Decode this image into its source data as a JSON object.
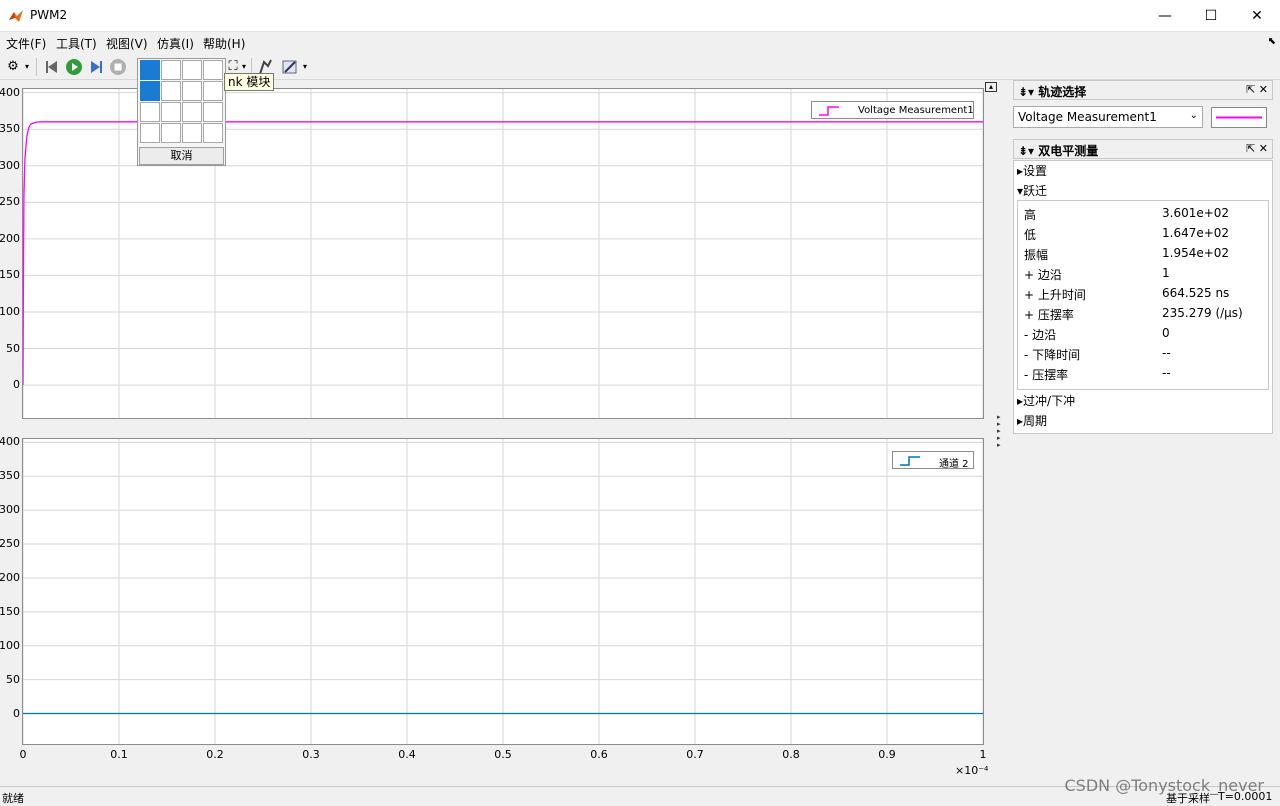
{
  "window": {
    "title": "PWM2",
    "minimize": "—",
    "maximize": "☐",
    "close": "✕"
  },
  "menu": [
    "文件(F)",
    "工具(T)",
    "视图(V)",
    "仿真(I)",
    "帮助(H)"
  ],
  "toolbar": {
    "icons": [
      "gear-icon",
      "dropdown-arrow-icon",
      "step-back-icon",
      "run-icon",
      "step-forward-icon",
      "stop-icon",
      "layout-icon",
      "zoom-icon",
      "highlight-block-icon",
      "style-icon"
    ]
  },
  "layout_popup": {
    "cancel_label": "取消",
    "rows": 4,
    "cols": 4,
    "selected_cells": [
      [
        0,
        0
      ],
      [
        1,
        0
      ]
    ]
  },
  "tooltip": "nk 模块",
  "chart_data": [
    {
      "type": "line",
      "title": "",
      "xlabel": "",
      "ylabel": "",
      "xlim": [
        0,
        1
      ],
      "ylim": [
        -45,
        405
      ],
      "x_tick_labels": [],
      "y_ticks": [
        0,
        50,
        100,
        150,
        200,
        250,
        300,
        350,
        400
      ],
      "grid": true,
      "legend": "top-right",
      "series": [
        {
          "name": "Voltage Measurement1",
          "color": "#ff00ff",
          "x": [
            0,
            0.0005,
            0.001,
            0.002,
            0.004,
            0.006,
            0.008,
            0.012,
            0.016,
            0.02,
            0.03,
            0.05,
            1
          ],
          "y": [
            0,
            165,
            260,
            310,
            340,
            352,
            357,
            359,
            360,
            360.1,
            360.1,
            360.1,
            360.1
          ]
        }
      ]
    },
    {
      "type": "line",
      "title": "",
      "xlabel": "",
      "ylabel": "",
      "xlim": [
        0,
        1
      ],
      "ylim": [
        -45,
        405
      ],
      "x_ticks": [
        0,
        0.1,
        0.2,
        0.3,
        0.4,
        0.5,
        0.6,
        0.7,
        0.8,
        0.9,
        1
      ],
      "x_tick_labels": [
        "0",
        "0.1",
        "0.2",
        "0.3",
        "0.4",
        "0.5",
        "0.6",
        "0.7",
        "0.8",
        "0.9",
        "1"
      ],
      "x_exponent": "×10⁻⁴",
      "y_ticks": [
        0,
        50,
        100,
        150,
        200,
        250,
        300,
        350,
        400
      ],
      "grid": true,
      "legend": "top-right",
      "series": [
        {
          "name": "通道 2",
          "color": "#0072bd",
          "x": [
            0,
            1
          ],
          "y": [
            0,
            0
          ]
        }
      ]
    }
  ],
  "trace_panel": {
    "title": "轨迹选择",
    "selected": "Voltage Measurement1",
    "line_color": "#ff00ff"
  },
  "bilevel_panel": {
    "title": "双电平测量",
    "sections": {
      "settings": "设置",
      "transitions": "跃迁",
      "overshoot": "过冲/下冲",
      "cycles": "周期"
    },
    "rows": [
      {
        "k": "高",
        "v": "3.601e+02"
      },
      {
        "k": "低",
        "v": "1.647e+02"
      },
      {
        "k": "振幅",
        "v": "1.954e+02"
      },
      {
        "k": "+ 边沿",
        "v": "1"
      },
      {
        "k": "+ 上升时间",
        "v": "664.525 ns"
      },
      {
        "k": "+ 压摆率",
        "v": "235.279 (/μs)"
      },
      {
        "k": "- 边沿",
        "v": "0"
      },
      {
        "k": "- 下降时间",
        "v": "--"
      },
      {
        "k": "- 压摆率",
        "v": "--"
      }
    ]
  },
  "status": {
    "left": "就绪",
    "sampling": "基于采样",
    "time": "T=0.0001"
  },
  "watermark": "CSDN @Tonystock_never"
}
